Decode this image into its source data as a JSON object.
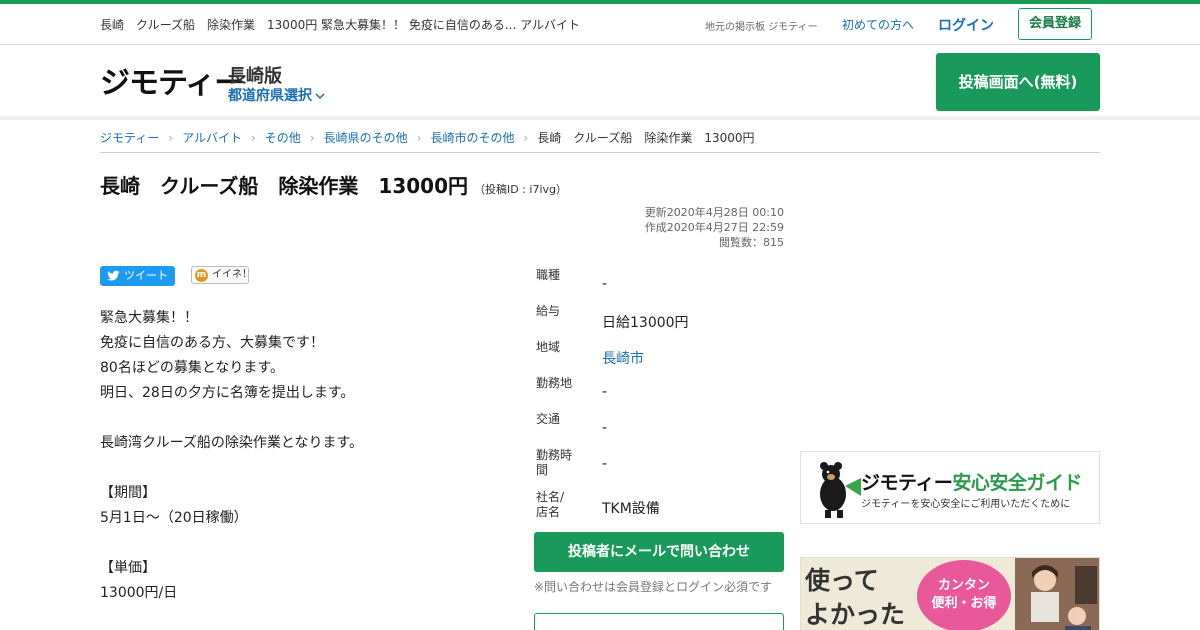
{
  "topbar": {
    "headline": "長崎　クルーズ船　除染作業　13000円 緊急大募集！！ 免疫に自信のある... アルバイト",
    "tagline": "地元の掲示板 ジモティー",
    "first_time": "初めての方へ",
    "login": "ログイン",
    "register": "会員登録"
  },
  "header": {
    "logo": "ジモティー",
    "edition": "長崎版",
    "pref_select": "都道府県選択",
    "post_button": "投稿画面へ(無料)"
  },
  "breadcrumb": [
    "ジモティー",
    "アルバイト",
    "その他",
    "長崎県のその他",
    "長崎市のその他",
    "長崎　クルーズ船　除染作業　13000円"
  ],
  "post": {
    "title": "長崎　クルーズ船　除染作業　13000円",
    "post_id": "（投稿ID : i7ivg）",
    "updated": "更新2020年4月28日 00:10",
    "created": "作成2020年4月27日 22:59",
    "views": "閲覧数：815",
    "tweet_label": "ツイート",
    "like_label": "イイネ！",
    "body_lines": [
      "緊急大募集！！",
      "免疫に自信のある方、大募集です！",
      "80名ほどの募集となります。",
      "明日、28日の夕方に名簿を提出します。",
      "",
      "長崎湾クルーズ船の除染作業となります。",
      "",
      "【期間】",
      "5月1日〜（20日稼働）",
      "",
      "【単価】",
      "13000円/日"
    ]
  },
  "details": [
    {
      "label": "職種",
      "value": "-"
    },
    {
      "label": "給与",
      "value": "日給13000円"
    },
    {
      "label": "地域",
      "value": "長崎市"
    },
    {
      "label": "勤務地",
      "value": "-"
    },
    {
      "label": "交通",
      "value": "-"
    },
    {
      "label": "勤務時間",
      "value": "-"
    },
    {
      "label": "社名/店名",
      "value": "TKM設備"
    }
  ],
  "contact": {
    "mail_button": "投稿者にメールで問い合わせ",
    "note": "※問い合わせは会員登録とログイン必須です"
  },
  "guide_banner": {
    "brand": "ジモティー",
    "highlight": "安心安全ガイド",
    "subtitle": "ジモティーを安心安全にご利用いただくために"
  },
  "promo_banner": {
    "line1": "使って",
    "line2": "よかった",
    "bubble1": "カンタン",
    "bubble2": "便利・お得"
  },
  "colors": {
    "brand_green": "#1a9a5a",
    "link_blue": "#1a6fb5",
    "twitter_blue": "#1d9bf0",
    "promo_pink": "#e8589a"
  }
}
